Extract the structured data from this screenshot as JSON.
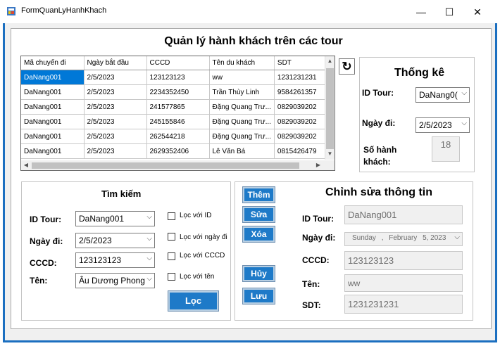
{
  "window": {
    "title": "FormQuanLyHanhKhach",
    "minimize": "—",
    "maximize": "☐",
    "close": "✕"
  },
  "form_title": "Quản lý hành khách trên các tour",
  "grid": {
    "columns": [
      "Mã chuyến đi",
      "Ngày bắt đầu",
      "CCCD",
      "Tên du khách",
      "SDT"
    ],
    "rows": [
      [
        "DaNang001",
        "2/5/2023",
        "123123123",
        "ww",
        "1231231231"
      ],
      [
        "DaNang001",
        "2/5/2023",
        "2234352450",
        "Trần Thùy Linh",
        "9584261357"
      ],
      [
        "DaNang001",
        "2/5/2023",
        "241577865",
        "Đặng Quang Trư...",
        "0829039202"
      ],
      [
        "DaNang001",
        "2/5/2023",
        "245155846",
        "Đặng Quang Trư...",
        "0829039202"
      ],
      [
        "DaNang001",
        "2/5/2023",
        "262544218",
        "Đặng Quang Trư...",
        "0829039202"
      ],
      [
        "DaNang001",
        "2/5/2023",
        "2629352406",
        "Lê Văn Bá",
        "0815426479"
      ]
    ],
    "selected_row": 0
  },
  "refresh_symbol": "↻",
  "stats": {
    "title": "Thống kê",
    "id_tour_label": "ID Tour:",
    "id_tour_value": "DaNang0(",
    "date_label": "Ngày đi:",
    "date_value": "2/5/2023",
    "count_label": "Số hành khách:",
    "count_value": "18"
  },
  "search": {
    "title": "Tìm kiếm",
    "id_tour_label": "ID Tour:",
    "id_tour_value": "DaNang001",
    "date_label": "Ngày đi:",
    "date_value": "2/5/2023",
    "cccd_label": "CCCD:",
    "cccd_value": "123123123",
    "name_label": "Tên:",
    "name_value": "Âu Dương Phong",
    "filters": [
      "Lọc với ID",
      "Lọc với ngày đi",
      "Lọc với CCCD",
      "Lọc với tên"
    ],
    "filter_button": "Lọc"
  },
  "actions": {
    "add": "Thêm",
    "edit": "Sửa",
    "delete": "Xóa",
    "cancel": "Hủy",
    "save": "Lưu"
  },
  "edit": {
    "title": "Chỉnh sửa thông tin",
    "id_tour_label": "ID Tour:",
    "id_tour_value": "DaNang001",
    "date_label": "Ngày đi:",
    "date_day": "Sunday",
    "date_month": "February",
    "date_rest": "5, 2023",
    "cccd_label": "CCCD:",
    "cccd_value": "123123123",
    "name_label": "Tên:",
    "name_value": "ww",
    "phone_label": "SDT:",
    "phone_value": "1231231231"
  },
  "colors": {
    "frame": "#1b6fc0",
    "button": "#1e7ac8",
    "selection": "#0078d7"
  }
}
